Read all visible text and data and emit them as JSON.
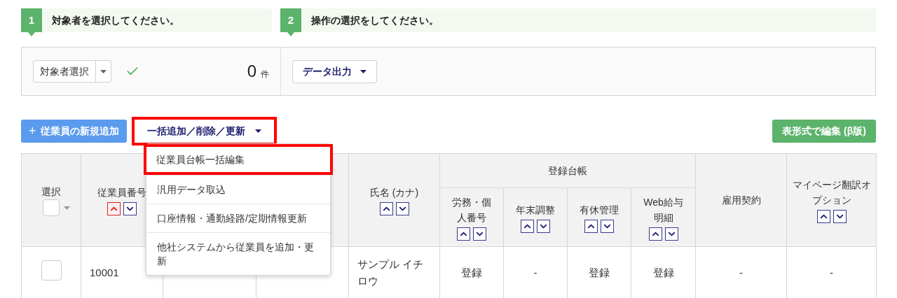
{
  "steps": [
    {
      "number": "1",
      "text": "対象者を選択してください。"
    },
    {
      "number": "2",
      "text": "操作の選択をしてください。"
    }
  ],
  "panel": {
    "target_select": "対象者選択",
    "checked": true,
    "count": "0",
    "count_unit": "件",
    "output_button": "データ出力"
  },
  "toolbar": {
    "add_button": "従業員の新規追加",
    "add_icon": "+",
    "bulk_button": {
      "label": "一括追加／削除／更新",
      "highlighted": true
    },
    "table_edit_button": "表形式で編集 (β版)"
  },
  "menu": {
    "items": [
      {
        "label": "従業員台帳一括編集",
        "highlighted": true
      },
      {
        "label": "汎用データ取込",
        "highlighted": false
      },
      {
        "label": "口座情報・通勤経路/定期情報更新",
        "highlighted": false
      },
      {
        "label": "他社システムから従業員を追加・更新",
        "highlighted": false
      }
    ]
  },
  "table": {
    "columns": [
      {
        "kind": "select",
        "label": "選択",
        "select_all_checked": false
      },
      {
        "kind": "plain",
        "label": "従業員番号",
        "sort_ascending": true
      },
      {
        "kind": "covered"
      },
      {
        "kind": "covered"
      },
      {
        "kind": "plain",
        "label": "氏名 (カナ)",
        "sort_ascending": false
      },
      {
        "kind": "group",
        "label": "登録台帳",
        "colspan": 4,
        "children": [
          {
            "label": "労務・個人番号",
            "sort_ascending": false
          },
          {
            "label": "年末調整",
            "sort_ascending": false
          },
          {
            "label": "有休管理",
            "sort_ascending": false
          },
          {
            "label": "Web給与明細",
            "sort_ascending": false
          }
        ]
      },
      {
        "kind": "plain",
        "label": "雇用契約"
      },
      {
        "kind": "plain",
        "label": "マイページ翻訳オプション",
        "sort_ascending": false
      }
    ],
    "rows": [
      {
        "checked": false,
        "cells": [
          "",
          "10001",
          "",
          "",
          "サンプル イチロウ",
          "登録",
          "-",
          "登録",
          "登録",
          "-",
          "-"
        ]
      }
    ]
  }
}
